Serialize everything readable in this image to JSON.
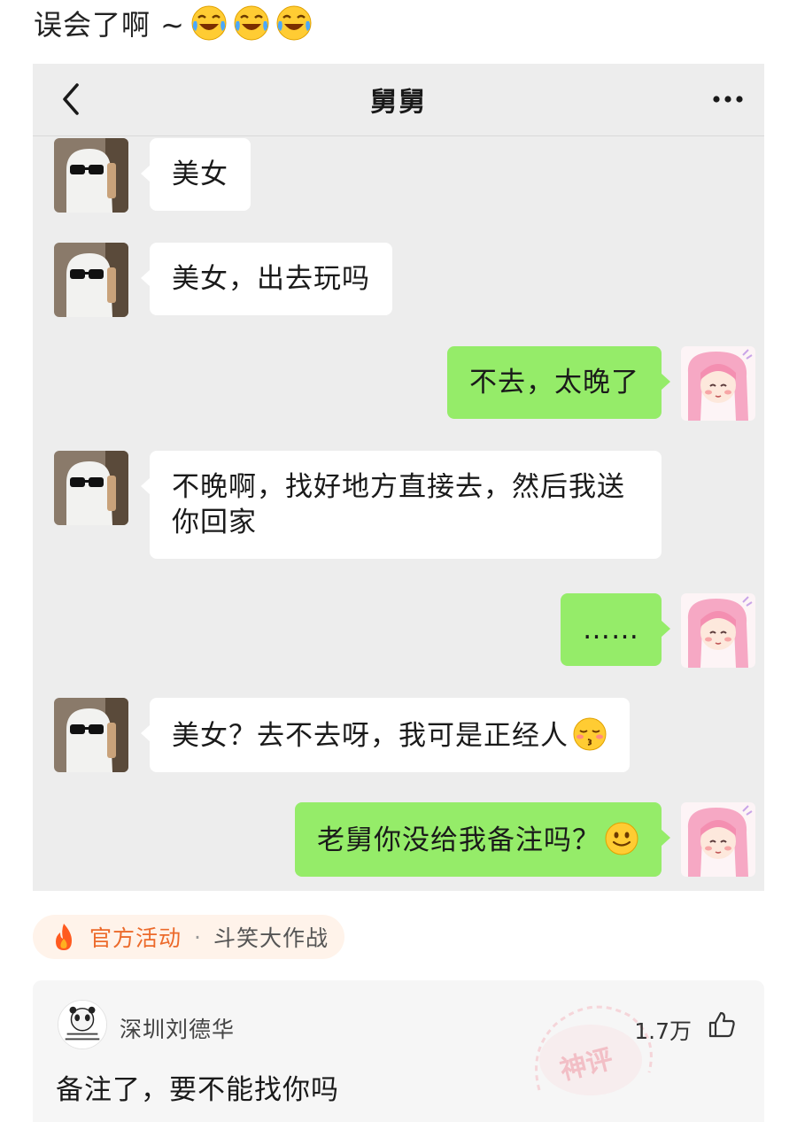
{
  "post": {
    "title": "误会了啊 ~",
    "title_emojis": [
      "face-with-tears-of-joy",
      "face-with-tears-of-joy",
      "face-with-tears-of-joy"
    ]
  },
  "chat": {
    "contact_name": "舅舅",
    "messages": [
      {
        "side": "in",
        "text": "美女"
      },
      {
        "side": "in",
        "text": "美女，出去玩吗"
      },
      {
        "side": "out",
        "text": "不去，太晚了"
      },
      {
        "side": "in",
        "text": "不晚啊，找好地方直接去，然后我送你回家"
      },
      {
        "side": "out",
        "text": "……"
      },
      {
        "side": "in",
        "text": "美女？去不去呀，我可是正经人",
        "emoji": "kissing-face-with-closed-eyes"
      },
      {
        "side": "out",
        "text": "老舅你没给我备注吗？",
        "emoji": "smiling-face"
      }
    ],
    "colors": {
      "background": "#ededed",
      "bubble_in": "#ffffff",
      "bubble_out": "#95ec69"
    }
  },
  "activity": {
    "icon": "flame-icon",
    "label": "官方活动",
    "separator": "·",
    "name": "斗笑大作战",
    "accent": "#ec6a2b"
  },
  "comment": {
    "user": "深圳刘德华",
    "likes": "1.7万",
    "text": "备注了，要不能找你吗",
    "stamp_text": "神评"
  }
}
